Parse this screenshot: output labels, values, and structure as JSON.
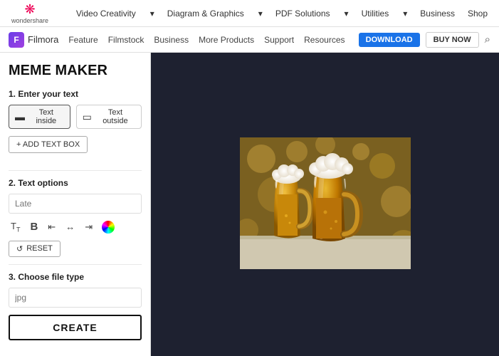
{
  "topNav": {
    "logo": "wondershare",
    "links": [
      {
        "label": "Video Creativity",
        "hasArrow": true
      },
      {
        "label": "Diagram & Graphics",
        "hasArrow": true
      },
      {
        "label": "PDF Solutions",
        "hasArrow": true
      },
      {
        "label": "Utilities",
        "hasArrow": true
      },
      {
        "label": "Business",
        "hasArrow": false
      },
      {
        "label": "Shop",
        "hasArrow": false
      }
    ]
  },
  "filmoraBar": {
    "logoText": "Filmora",
    "navLinks": [
      "Feature",
      "Filmstock",
      "Business",
      "More Products",
      "Support",
      "Resources"
    ],
    "downloadBtn": "DOWNLOAD",
    "buyNowBtn": "BUY NOW"
  },
  "sidebar": {
    "title": "MEME MAKER",
    "step1Label": "1. Enter your text",
    "textInsideLabel": "Text inside",
    "textOutsideLabel": "Text outside",
    "addTextBoxBtn": "+ ADD TEXT BOX",
    "step2Label": "2. Text options",
    "textInputPlaceholder": "Late",
    "resetBtn": "RESET",
    "step3Label": "3. Choose file type",
    "fileTypeValue": "jpg",
    "createBtn": "CREATE"
  }
}
